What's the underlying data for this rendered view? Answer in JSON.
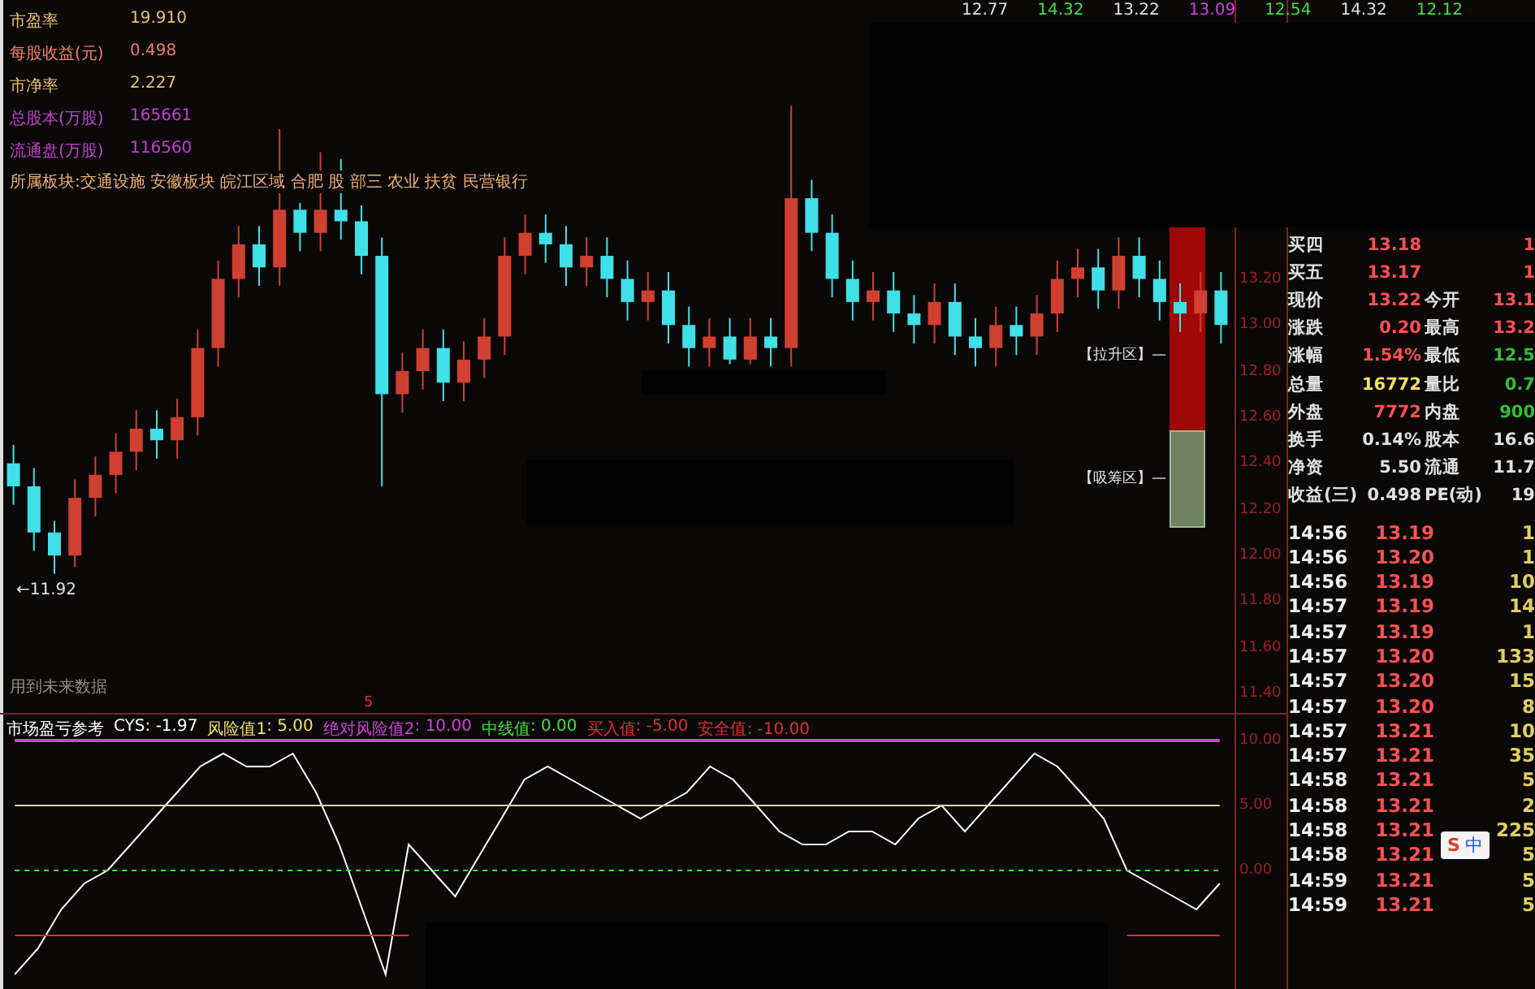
{
  "header": {
    "values": [
      "12.77",
      "14.32",
      "13.22",
      "13.09",
      "12.54",
      "14.32",
      "12.12"
    ]
  },
  "stock_info": [
    {
      "label": "市盈率",
      "value": "19.910",
      "color": "#e8c070"
    },
    {
      "label": "每股收益(元)",
      "value": "0.498",
      "color": "#f08060"
    },
    {
      "label": "市净率",
      "value": "2.227",
      "color": "#e8c070"
    },
    {
      "label": "总股本(万股)",
      "value": "165661",
      "color": "#c040d0"
    },
    {
      "label": "流通盘(万股)",
      "value": "116560",
      "color": "#c040d0"
    }
  ],
  "sector": "所属板块:交通设施 安徽板块 皖江区域 合肥 股 部三 农业 扶贫 民营银行",
  "price_chart": {
    "low_marker": "←11.92",
    "future_data_note": "用到未来数据",
    "zones": [
      {
        "label": "【拉升区】—"
      },
      {
        "label": "【吸筹区】—"
      }
    ],
    "chart_data": {
      "type": "candlestick",
      "ylim": [
        11.31,
        14.41
      ],
      "yticks": [
        {
          "value": 13.2,
          "label": "13.20"
        },
        {
          "value": 13.0,
          "label": "13.00"
        },
        {
          "value": 12.8,
          "label": "12.80"
        },
        {
          "value": 12.6,
          "label": "12.60"
        },
        {
          "value": 12.4,
          "label": "12.40"
        },
        {
          "value": 12.2,
          "label": "12.20"
        },
        {
          "value": 12.0,
          "label": "12.00"
        },
        {
          "value": 11.8,
          "label": "11.80"
        },
        {
          "value": 11.6,
          "label": "11.60"
        },
        {
          "value": 11.4,
          "label": "11.40"
        }
      ],
      "ohlc": [
        [
          12.4,
          12.48,
          12.22,
          12.3
        ],
        [
          12.3,
          12.38,
          12.02,
          12.1
        ],
        [
          12.1,
          12.15,
          11.92,
          12.0
        ],
        [
          12.0,
          12.33,
          11.95,
          12.25
        ],
        [
          12.25,
          12.43,
          12.17,
          12.35
        ],
        [
          12.35,
          12.53,
          12.27,
          12.45
        ],
        [
          12.45,
          12.63,
          12.37,
          12.55
        ],
        [
          12.55,
          12.63,
          12.42,
          12.5
        ],
        [
          12.5,
          12.68,
          12.42,
          12.6
        ],
        [
          12.6,
          12.98,
          12.52,
          12.9
        ],
        [
          12.9,
          13.28,
          12.82,
          13.2
        ],
        [
          13.2,
          13.43,
          13.12,
          13.35
        ],
        [
          13.35,
          13.43,
          13.17,
          13.25
        ],
        [
          13.25,
          13.85,
          13.17,
          13.5
        ],
        [
          13.5,
          13.53,
          13.32,
          13.4
        ],
        [
          13.4,
          13.75,
          13.32,
          13.5
        ],
        [
          13.5,
          13.72,
          13.37,
          13.45
        ],
        [
          13.45,
          13.52,
          13.22,
          13.3
        ],
        [
          13.3,
          13.38,
          12.3,
          12.7
        ],
        [
          12.7,
          12.88,
          12.62,
          12.8
        ],
        [
          12.8,
          12.98,
          12.72,
          12.9
        ],
        [
          12.9,
          12.98,
          12.67,
          12.75
        ],
        [
          12.75,
          12.93,
          12.67,
          12.85
        ],
        [
          12.85,
          13.03,
          12.77,
          12.95
        ],
        [
          12.95,
          13.38,
          12.87,
          13.3
        ],
        [
          13.3,
          13.48,
          13.22,
          13.4
        ],
        [
          13.4,
          13.48,
          13.27,
          13.35
        ],
        [
          13.35,
          13.43,
          13.17,
          13.25
        ],
        [
          13.25,
          13.38,
          13.17,
          13.3
        ],
        [
          13.3,
          13.38,
          13.12,
          13.2
        ],
        [
          13.2,
          13.28,
          13.02,
          13.1
        ],
        [
          13.1,
          13.23,
          13.02,
          13.15
        ],
        [
          13.15,
          13.23,
          12.92,
          13.0
        ],
        [
          13.0,
          13.08,
          12.82,
          12.9
        ],
        [
          12.9,
          13.03,
          12.82,
          12.95
        ],
        [
          12.95,
          13.03,
          12.83,
          12.85
        ],
        [
          12.85,
          13.03,
          12.83,
          12.95
        ],
        [
          12.95,
          13.03,
          12.82,
          12.9
        ],
        [
          12.9,
          13.95,
          12.82,
          13.55
        ],
        [
          13.55,
          13.63,
          13.32,
          13.4
        ],
        [
          13.4,
          13.48,
          13.12,
          13.2
        ],
        [
          13.2,
          13.28,
          13.02,
          13.1
        ],
        [
          13.1,
          13.23,
          13.02,
          13.15
        ],
        [
          13.15,
          13.23,
          12.97,
          13.05
        ],
        [
          13.05,
          13.13,
          12.92,
          13.0
        ],
        [
          13.0,
          13.18,
          12.92,
          13.1
        ],
        [
          13.1,
          13.18,
          12.87,
          12.95
        ],
        [
          12.95,
          13.03,
          12.82,
          12.9
        ],
        [
          12.9,
          13.08,
          12.82,
          13.0
        ],
        [
          13.0,
          13.08,
          12.87,
          12.95
        ],
        [
          12.95,
          13.13,
          12.87,
          13.05
        ],
        [
          13.05,
          13.28,
          12.97,
          13.2
        ],
        [
          13.2,
          13.33,
          13.12,
          13.25
        ],
        [
          13.25,
          13.33,
          13.07,
          13.15
        ],
        [
          13.15,
          13.38,
          13.07,
          13.3
        ],
        [
          13.3,
          13.38,
          13.12,
          13.2
        ],
        [
          13.2,
          13.28,
          13.02,
          13.1
        ],
        [
          13.1,
          13.18,
          12.97,
          13.05
        ],
        [
          13.05,
          13.23,
          12.97,
          13.15
        ],
        [
          13.15,
          13.23,
          12.92,
          13.0
        ]
      ]
    }
  },
  "indicator": {
    "title": "市场盈亏参考",
    "readings": [
      ": -1.97",
      ": 5.00",
      ": 10.00",
      ": 0.00",
      ": -5.00"
    ],
    "items": [
      {
        "text": "安全值: -10.00",
        "color": "#e03030"
      }
    ],
    "marker": "5",
    "chart_data": {
      "type": "line",
      "ylim": [
        -9.125,
        12
      ],
      "yticks": [
        {
          "value": 10,
          "label": "10.00"
        },
        {
          "value": 5,
          "label": "5.00"
        },
        {
          "value": 0,
          "label": "0.00"
        }
      ],
      "series": [
        {
          "name": "CYS",
          "color": "#ffffff",
          "values": [
            -8,
            -6,
            -3,
            -1,
            0,
            2,
            4,
            6,
            8,
            9,
            8,
            8,
            9,
            6,
            2,
            -3,
            -8,
            2,
            0,
            -2,
            1,
            4,
            7,
            8,
            7,
            6,
            5,
            4,
            5,
            6,
            8,
            7,
            5,
            3,
            2,
            2,
            3,
            3,
            2,
            4,
            5,
            3,
            5,
            7,
            9,
            8,
            6,
            4,
            0,
            -1,
            -2,
            -3,
            -1
          ]
        },
        {
          "name": "风险值1",
          "color": "#f0e060",
          "values": [
            5,
            5,
            5,
            5,
            5,
            5,
            5,
            5,
            5,
            5,
            5,
            5,
            5,
            5,
            5,
            5,
            5,
            5,
            5,
            5,
            5,
            5,
            5,
            5,
            5,
            5,
            5,
            5,
            5,
            5,
            5,
            5,
            5,
            5,
            5,
            5,
            5,
            5,
            5,
            5,
            5,
            5,
            5,
            5,
            5,
            5,
            5,
            5,
            5,
            5,
            5,
            5,
            5
          ]
        },
        {
          "name": "绝对风险值2",
          "color": "#d040e0",
          "values": [
            10,
            10,
            10,
            10,
            10,
            10,
            10,
            10,
            10,
            10,
            10,
            10,
            10,
            10,
            10,
            10,
            10,
            10,
            10,
            10,
            10,
            10,
            10,
            10,
            10,
            10,
            10,
            10,
            10,
            10,
            10,
            10,
            10,
            10,
            10,
            10,
            10,
            10,
            10,
            10,
            10,
            10,
            10,
            10,
            10,
            10,
            10,
            10,
            10,
            10,
            10,
            10,
            10
          ]
        },
        {
          "name": "中线值",
          "color": "#40e040",
          "line_style": "dashed",
          "values": [
            0,
            0,
            0,
            0,
            0,
            0,
            0,
            0,
            0,
            0,
            0,
            0,
            0,
            0,
            0,
            0,
            0,
            0,
            0,
            0,
            0,
            0,
            0,
            0,
            0,
            0,
            0,
            0,
            0,
            0,
            0,
            0,
            0,
            0,
            0,
            0,
            0,
            0,
            0,
            0,
            0,
            0,
            0,
            0,
            0,
            0,
            0,
            0,
            0,
            0,
            0,
            0,
            0
          ]
        },
        {
          "name": "买入值",
          "color": "#e03030",
          "values": [
            -5,
            -5,
            -5,
            -5,
            -5,
            -5,
            -5,
            -5,
            -5,
            -5,
            -5,
            -5,
            -5,
            -5,
            -5,
            -5,
            -5,
            -5,
            null,
            null,
            null,
            null,
            null,
            null,
            null,
            null,
            null,
            null,
            null,
            null,
            null,
            null,
            null,
            null,
            null,
            null,
            null,
            null,
            null,
            null,
            null,
            null,
            null,
            null,
            null,
            null,
            null,
            null,
            -5,
            -5,
            -5,
            -5,
            -5
          ]
        }
      ]
    }
  },
  "quotes": [
    {
      "label": "买四",
      "value": "13.18",
      "value2": "1",
      "kind": "price"
    },
    {
      "label": "买五",
      "value": "13.17",
      "value2": "1",
      "kind": "price"
    },
    {
      "label": "现价",
      "value": "13.22",
      "label2": "今开",
      "value2": "13.1",
      "kind": "price"
    },
    {
      "label": "涨跌",
      "value": "0.20",
      "label2": "最高",
      "value2": "13.2",
      "kind": "price"
    },
    {
      "label": "涨幅",
      "value": "1.54%",
      "label2": "最低",
      "value2": "12.5",
      "kind": "low"
    },
    {
      "label": "总量",
      "value": "16772",
      "label2": "量比",
      "value2": "0.7",
      "kind": "volume"
    },
    {
      "label": "外盘",
      "value": "7772",
      "label2": "内盘",
      "value2": "900",
      "kind": "outer"
    },
    {
      "label": "换手",
      "value": "0.14%",
      "label2": "股本",
      "value2": "16.6",
      "kind": "plain"
    },
    {
      "label": "净资",
      "value": "5.50",
      "label2": "流通",
      "value2": "11.7",
      "kind": "plain"
    },
    {
      "label": "收益(三)",
      "value": "0.498",
      "label2": "PE(动)",
      "value2": "19",
      "kind": "plain"
    }
  ],
  "ticks": [
    {
      "time": "14:56",
      "price": "13.19",
      "volume": "1"
    },
    {
      "time": "14:56",
      "price": "13.20",
      "volume": "1"
    },
    {
      "time": "14:56",
      "price": "13.19",
      "volume": "10"
    },
    {
      "time": "14:57",
      "price": "13.19",
      "volume": "14"
    },
    {
      "time": "14:57",
      "price": "13.19",
      "volume": "1"
    },
    {
      "time": "14:57",
      "price": "13.20",
      "volume": "133"
    },
    {
      "time": "14:57",
      "price": "13.20",
      "volume": "15"
    },
    {
      "time": "14:57",
      "price": "13.20",
      "volume": "8"
    },
    {
      "time": "14:57",
      "price": "13.21",
      "volume": "10"
    },
    {
      "time": "14:57",
      "price": "13.21",
      "volume": "35"
    },
    {
      "time": "14:58",
      "price": "13.21",
      "volume": "5"
    },
    {
      "time": "14:58",
      "price": "13.21",
      "volume": "2"
    },
    {
      "time": "14:58",
      "price": "13.21",
      "volume": "225"
    },
    {
      "time": "14:58",
      "price": "13.21",
      "volume": "5"
    },
    {
      "time": "14:59",
      "price": "13.21",
      "volume": "5"
    },
    {
      "time": "14:59",
      "price": "13.21",
      "volume": "5"
    }
  ],
  "ime": {
    "logo": "S",
    "label": "中"
  }
}
